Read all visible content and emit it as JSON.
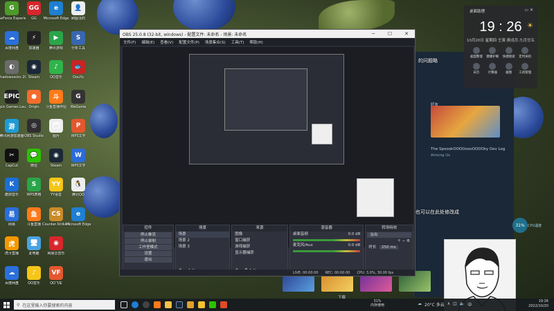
{
  "desktop_icons": [
    {
      "label": "GeForce Experience",
      "color": "#4c9a2a",
      "glyph": "G"
    },
    {
      "label": "GG",
      "color": "#d8262c",
      "glyph": "GG"
    },
    {
      "label": "Microsoft Edge",
      "color": "#1f7fd1",
      "glyph": "e"
    },
    {
      "label": "刷图活的",
      "color": "#eeeeee",
      "glyph": "👤"
    },
    {
      "label": "百度网盘",
      "color": "#2a6fdb",
      "glyph": "☁"
    },
    {
      "label": "加速器",
      "color": "#222",
      "glyph": "⚡"
    },
    {
      "label": "腾讯游戏",
      "color": "#2aa54a",
      "glyph": "▶"
    },
    {
      "label": "分析工具",
      "color": "#3866b0",
      "glyph": "S"
    },
    {
      "label": "Shadowsocks 2020",
      "color": "#6b6b6b",
      "glyph": "◐"
    },
    {
      "label": "Steam",
      "color": "#1b2838",
      "glyph": "◉"
    },
    {
      "label": "QQ音乐",
      "color": "#2fb34a",
      "glyph": "♪"
    },
    {
      "label": "DouYu",
      "color": "#c72525",
      "glyph": "🐟"
    },
    {
      "label": "Epic Games Launcher",
      "color": "#222",
      "glyph": "EPIC"
    },
    {
      "label": "Origin",
      "color": "#f56c2d",
      "glyph": "●"
    },
    {
      "label": "斗鱼直播伴侣",
      "color": "#ff7a1a",
      "glyph": "斗"
    },
    {
      "label": "WeGame",
      "color": "#333",
      "glyph": "G"
    },
    {
      "label": "腾讯网游加速器",
      "color": "#1d9bd6",
      "glyph": "游"
    },
    {
      "label": "OBS Studio",
      "color": "#302e31",
      "glyph": "◎"
    },
    {
      "label": "图片",
      "color": "#eee",
      "glyph": "🗂"
    },
    {
      "label": "WPS文字",
      "color": "#e4572e",
      "glyph": "P"
    },
    {
      "label": "CapCut",
      "color": "#111",
      "glyph": "✂"
    },
    {
      "label": "微信",
      "color": "#2dc100",
      "glyph": "💬"
    },
    {
      "label": "Steam",
      "color": "#1b2838",
      "glyph": "◉"
    },
    {
      "label": "WPS文字",
      "color": "#2c6cd6",
      "glyph": "W"
    },
    {
      "label": "酷狗音乐",
      "color": "#1b6fd6",
      "glyph": "K"
    },
    {
      "label": "WPS表格",
      "color": "#2aa54a",
      "glyph": "S"
    },
    {
      "label": "YY语音",
      "color": "#f5c518",
      "glyph": "YY"
    },
    {
      "label": "腾讯QQ",
      "color": "#eee",
      "glyph": "🐧"
    },
    {
      "label": "网易",
      "color": "#2a6fdb",
      "glyph": "易"
    },
    {
      "label": "斗鱼直播",
      "color": "#ff7a1a",
      "glyph": "鱼"
    },
    {
      "label": "Counter-Strike Global ...",
      "color": "#c98b2a",
      "glyph": "CS"
    },
    {
      "label": "Microsoft Edge",
      "color": "#1f7fd1",
      "glyph": "e"
    },
    {
      "label": "虎牙直播",
      "color": "#f39800",
      "glyph": "虎"
    },
    {
      "label": "此电脑",
      "color": "#4aa3e0",
      "glyph": "🖥"
    },
    {
      "label": "网易云音乐",
      "color": "#d8262c",
      "glyph": "◉"
    },
    {
      "label": "",
      "color": "transparent",
      "glyph": ""
    },
    {
      "label": "百度网盘",
      "color": "#2a6fdb",
      "glyph": "☁"
    },
    {
      "label": "QQ音乐",
      "color": "#f5c518",
      "glyph": "♪"
    },
    {
      "label": "QQ飞车",
      "color": "#e4572e",
      "glyph": "VF"
    },
    {
      "label": "",
      "color": "transparent",
      "glyph": ""
    }
  ],
  "obs": {
    "title": "OBS 25.0.8 (32-bit, windows) - 配置文件: 未命名 - 场景: 未命名",
    "menu": [
      "文件(F)",
      "编辑(E)",
      "查看(V)",
      "配置文件(P)",
      "场景集合(S)",
      "工具(T)",
      "帮助(H)"
    ],
    "docks": {
      "controls": {
        "title": "控件",
        "buttons": [
          "停止推流",
          "停止录制",
          "工作室模式",
          "设置",
          "退出"
        ]
      },
      "scenes": {
        "title": "场景",
        "items": [
          "场景",
          "场景 2",
          "场景 3"
        ]
      },
      "sources": {
        "title": "来源",
        "items": [
          "图像",
          "窗口捕获",
          "游戏捕获",
          "显示器捕获"
        ]
      },
      "mixer": {
        "title": "混音器",
        "tracks": [
          "桌面音频",
          "麦克风/Aux"
        ],
        "db": [
          "0.0 dB",
          "0.0 dB"
        ]
      },
      "transitions": {
        "title": "转场特效",
        "type": "淡出",
        "duration_label": "时长",
        "duration": "250 ms"
      }
    },
    "status": {
      "live": "LIVE: 00:00:00",
      "rec": "REC: 00:00:00",
      "cpu": "CPU: 3.0%, 30.00 fps"
    }
  },
  "steam": {
    "header": "好友",
    "game_title": "The SpoookOOOOoooOOOOky Dev Log",
    "game_sub": "Among Us",
    "download_label": "下载"
  },
  "overlay_text": {
    "top": "的问题略",
    "middle": "也可以在此处修改成"
  },
  "widget": {
    "title": "桌面助理",
    "time": "19 : 26",
    "date": "10月20日  星期四  壬寅·庚戌月·九月廿五",
    "items": [
      "桌面整理",
      "健康护眼",
      "快捷搜索",
      "定时关机",
      "日历",
      "计算器",
      "截图",
      "工具管理"
    ]
  },
  "cpu": {
    "value": "31%",
    "label": "CPU温度"
  },
  "taskbar": {
    "search_placeholder": "在这里输入你要搜索的内容",
    "memory_value": "31%",
    "memory_label": "内存使用",
    "weather": "20°C 多云",
    "lang": "中",
    "time": "19:26",
    "date": "2022/10/20"
  }
}
